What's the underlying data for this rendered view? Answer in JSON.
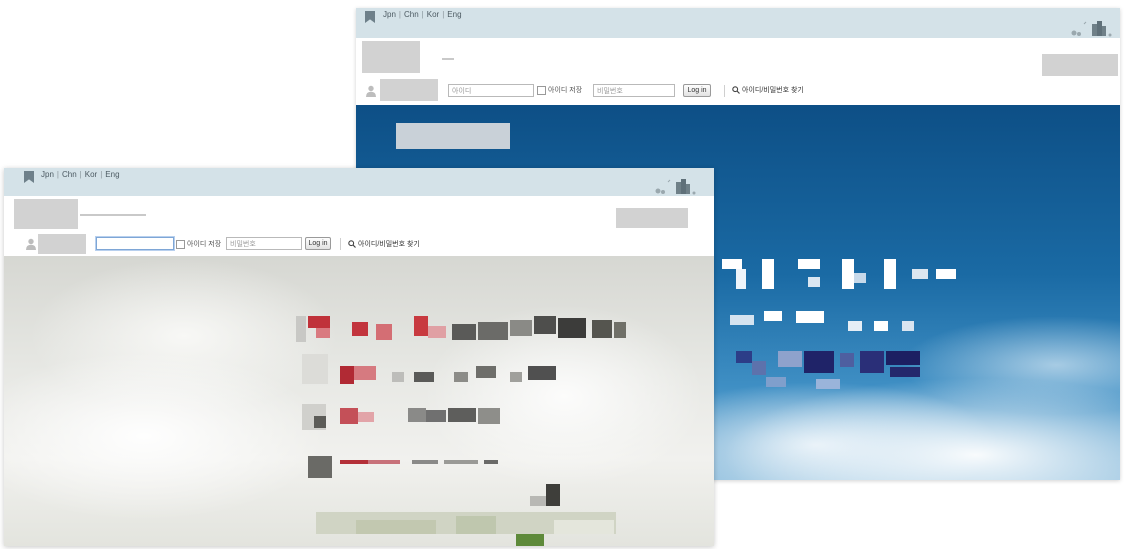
{
  "header": {
    "languages": [
      "Jpn",
      "Chn",
      "Kor",
      "Eng"
    ],
    "language_separator": "|"
  },
  "login": {
    "id_placeholder": "아이디",
    "save_id_label": "아이디 저장",
    "password_placeholder": "비밀번호",
    "login_button": "Log in",
    "find_label": "아이디/비밀번호 찾기"
  },
  "colors": {
    "topbar": "#d4e2e8",
    "hero_back_sky": "#1a6aa4",
    "hero_front_cloud": "#e7e8e4",
    "accent_red": "#b8303c",
    "accent_navy": "#1f1f5c"
  },
  "icons": [
    "bookmark-icon",
    "city-skyline-icon",
    "user-icon",
    "search-icon"
  ]
}
